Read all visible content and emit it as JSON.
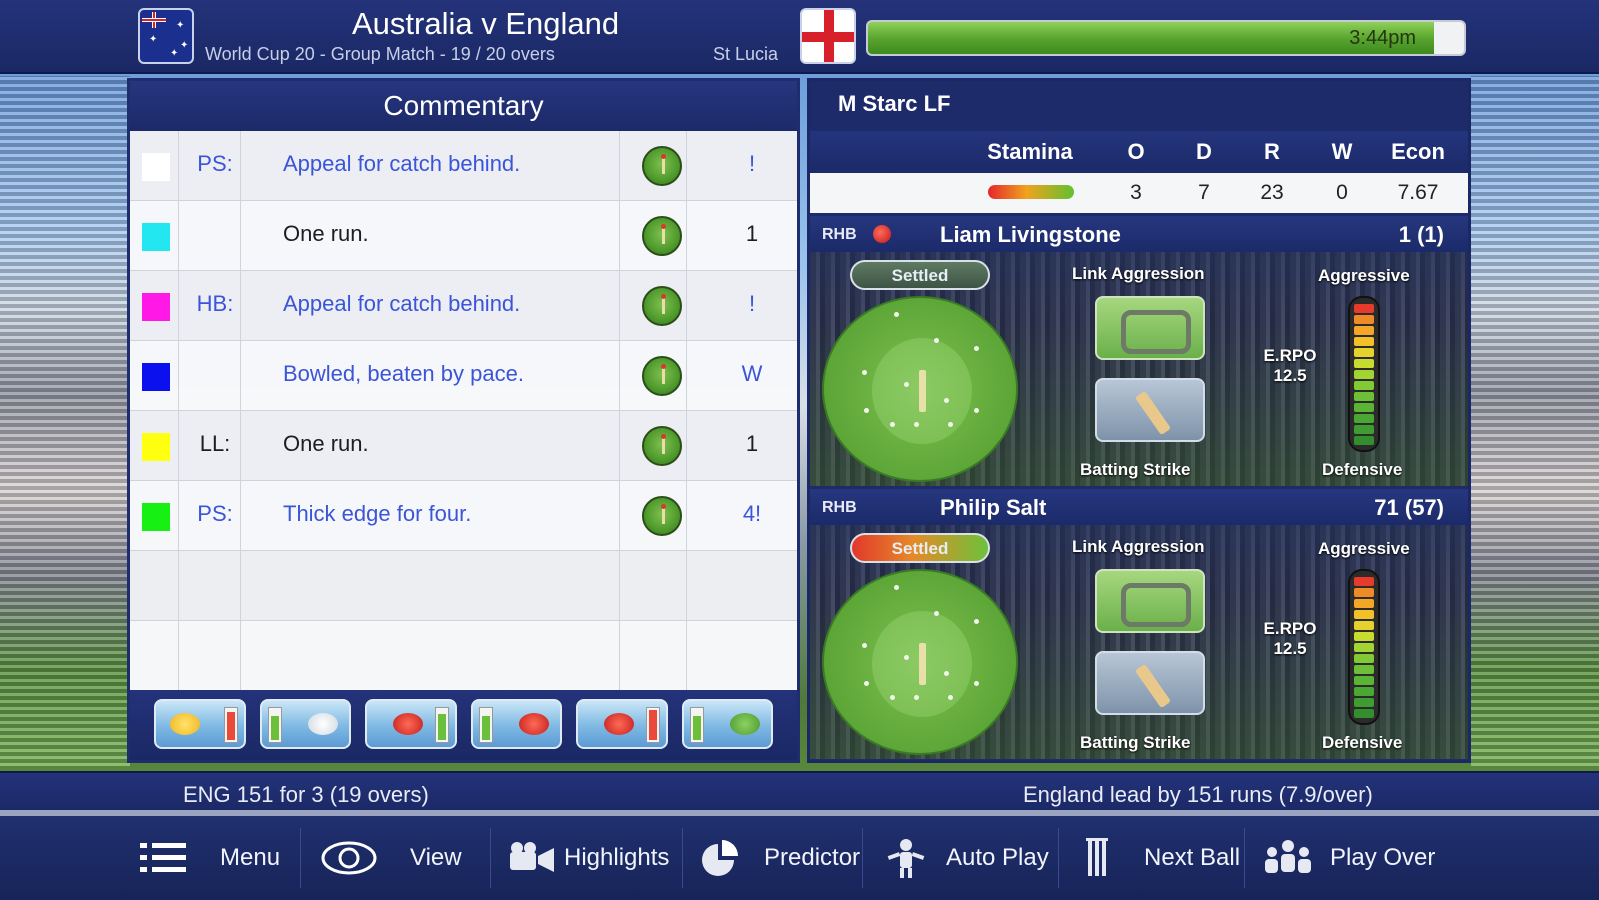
{
  "header": {
    "match_title": "Australia v England",
    "match_subtitle": "World Cup 20 - Group Match - 19 / 20 overs",
    "venue": "St Lucia",
    "time": "3:44pm",
    "progress_fraction": 0.95
  },
  "commentary": {
    "title": "Commentary",
    "rows": [
      {
        "color": "#ffffff",
        "batter": "PS:",
        "text": "Appeal for catch behind.",
        "result": "!",
        "style": "blue"
      },
      {
        "color": "#22e6f0",
        "batter": "",
        "text": "One run.",
        "result": "1",
        "style": "dark"
      },
      {
        "color": "#ff18e6",
        "batter": "HB:",
        "text": "Appeal for catch behind.",
        "result": "!",
        "style": "blue"
      },
      {
        "color": "#0a10ee",
        "batter": "",
        "text": "Bowled, beaten by pace.",
        "result": "W",
        "style": "blue"
      },
      {
        "color": "#ffff10",
        "batter": "LL:",
        "text": "One run.",
        "result": "1",
        "style": "dark"
      },
      {
        "color": "#16f012",
        "batter": "PS:",
        "text": "Thick edge for four.",
        "result": "4!",
        "style": "blue"
      }
    ]
  },
  "bowler": {
    "name": "M Starc LF",
    "headers": {
      "stamina": "Stamina",
      "o": "O",
      "d": "D",
      "r": "R",
      "w": "W",
      "econ": "Econ"
    },
    "stats": {
      "o": "3",
      "d": "7",
      "r": "23",
      "w": "0",
      "econ": "7.67"
    }
  },
  "batsmen": [
    {
      "hand": "RHB",
      "name": "Liam Livingstone",
      "score": "1 (1)",
      "status": "Settled",
      "link_label": "Link Aggression",
      "aggressive_label": "Aggressive",
      "strike_label": "Batting Strike",
      "defensive_label": "Defensive",
      "erpo_label": "E.RPO",
      "erpo_value": "12.5",
      "on_strike": true
    },
    {
      "hand": "RHB",
      "name": "Philip Salt",
      "score": "71 (57)",
      "status": "Settled",
      "link_label": "Link Aggression",
      "aggressive_label": "Aggressive",
      "strike_label": "Batting Strike",
      "defensive_label": "Defensive",
      "erpo_label": "E.RPO",
      "erpo_value": "12.5",
      "on_strike": false
    }
  ],
  "status": {
    "left": "ENG  151 for 3  (19 overs)",
    "right": "England lead by 151 runs (7.9/over)"
  },
  "nav": {
    "menu": "Menu",
    "view": "View",
    "highlights": "Highlights",
    "predictor": "Predictor",
    "auto_play": "Auto Play",
    "next_ball": "Next Ball",
    "play_over": "Play Over"
  },
  "colors": {
    "navy": "#1c2a69",
    "accent_green": "#5aa62f",
    "link_blue": "#3a55d8"
  }
}
